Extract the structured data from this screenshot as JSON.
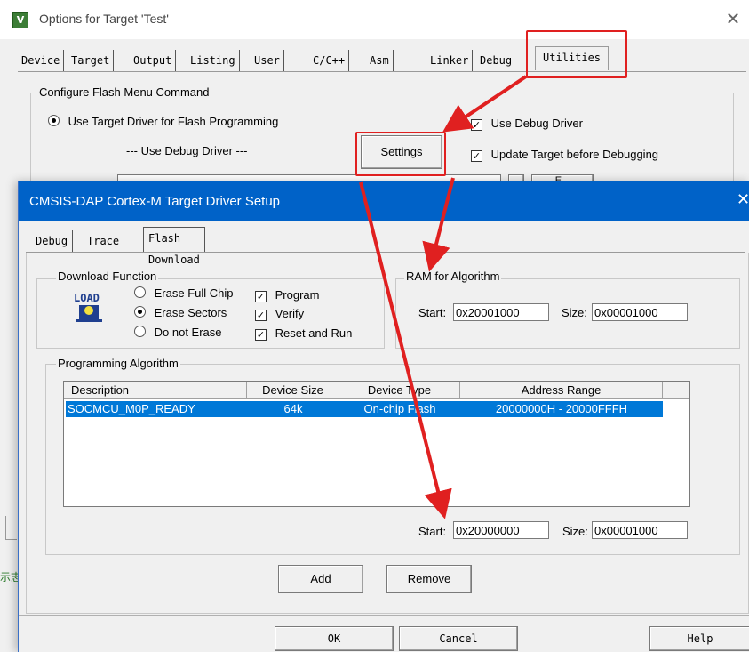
{
  "outer": {
    "title": "Options for Target 'Test'",
    "icon": "keil-logo-icon",
    "tabs": [
      "Device",
      "Target",
      "Output",
      "Listing",
      "User",
      "C/C++",
      "Asm",
      "Linker",
      "Debug",
      "Utilities"
    ],
    "group_title": "Configure Flash Menu Command",
    "use_target_driver": "Use Target Driver for Flash Programming",
    "debug_driver_label": "--- Use Debug Driver ---",
    "settings_button": "Settings",
    "use_debug_driver": "Use Debug Driver",
    "update_target": "Update Target before Debugging",
    "partial_button": "E...",
    "side_text": "示志"
  },
  "inner": {
    "title": "CMSIS-DAP Cortex-M Target Driver Setup",
    "tabs": [
      "Debug",
      "Trace",
      "Flash Download"
    ],
    "download_function": {
      "title": "Download Function",
      "logo": "LOAD",
      "erase_full": "Erase Full Chip",
      "erase_sectors": "Erase Sectors",
      "do_not_erase": "Do not Erase",
      "program": "Program",
      "verify": "Verify",
      "reset_run": "Reset and Run"
    },
    "ram": {
      "title": "RAM for Algorithm",
      "start_label": "Start:",
      "start_value": "0x20001000",
      "size_label": "Size:",
      "size_value": "0x00001000"
    },
    "programming": {
      "title": "Programming Algorithm",
      "columns": [
        "Description",
        "Device Size",
        "Device Type",
        "Address Range"
      ],
      "rows": [
        [
          "SOCMCU_M0P_READY",
          "64k",
          "On-chip Flash",
          "20000000H - 20000FFFH"
        ]
      ],
      "start_label": "Start:",
      "start_value": "0x20000000",
      "size_label": "Size:",
      "size_value": "0x00001000"
    },
    "add_button": "Add",
    "remove_button": "Remove",
    "ok_button": "OK",
    "cancel_button": "Cancel",
    "help_button": "Help"
  },
  "colors": {
    "title_blue": "#0062c8",
    "selection": "#0078d7",
    "annotation_red": "#e02020"
  }
}
